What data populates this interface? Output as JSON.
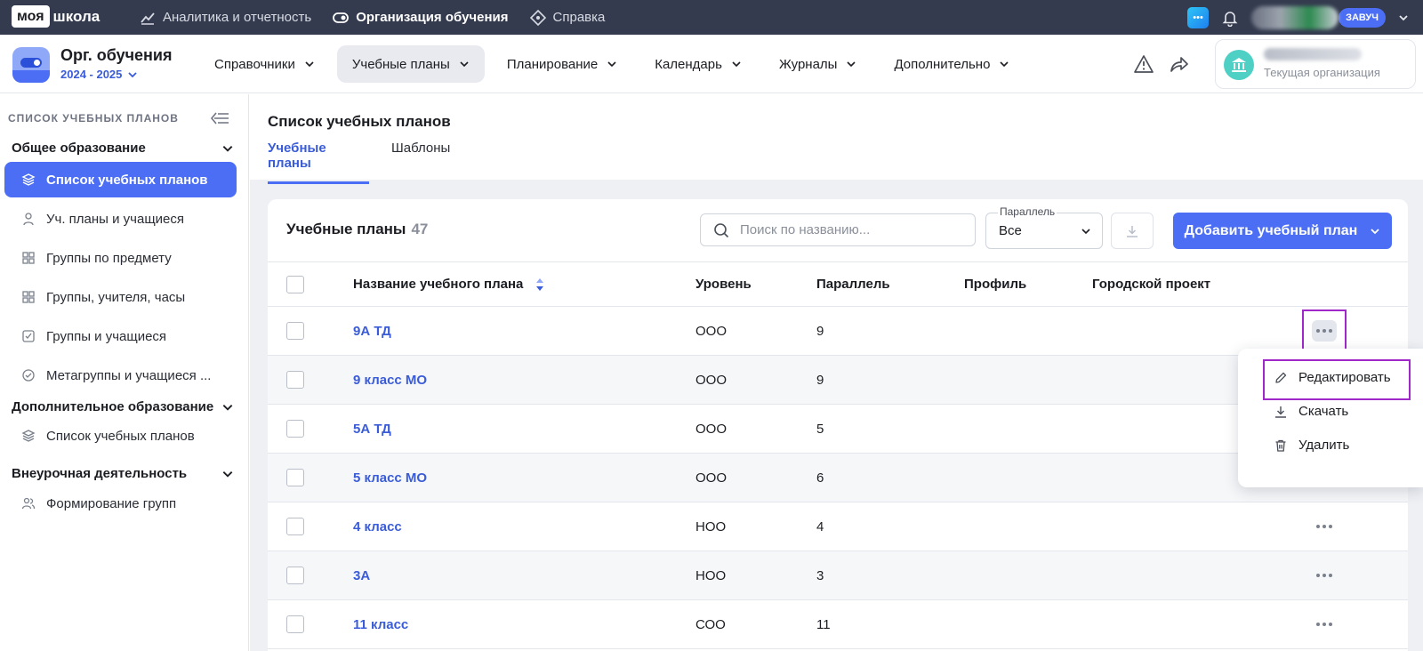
{
  "topbar": {
    "logo_part1": "моя",
    "logo_part2": "школа",
    "nav": [
      {
        "label": "Аналитика и отчетность",
        "icon": "chart-line-icon"
      },
      {
        "label": "Организация обучения",
        "icon": "toggle-icon"
      },
      {
        "label": "Справка",
        "icon": "diamond-icon"
      }
    ],
    "role_badge": "ЗАВУЧ"
  },
  "subbar": {
    "org_title": "Орг. обучения",
    "org_year": "2024 - 2025",
    "nav": [
      "Справочники",
      "Учебные планы",
      "Планирование",
      "Календарь",
      "Журналы",
      "Дополнительно"
    ],
    "org_card_label": "Текущая организация"
  },
  "sidebar": {
    "header": "СПИСОК УЧЕБНЫХ ПЛАНОВ",
    "groups": [
      {
        "title": "Общее образование",
        "items": [
          "Список учебных планов",
          "Уч. планы и учащиеся",
          "Группы по предмету",
          "Группы, учителя, часы",
          "Группы и учащиеся",
          "Метагруппы и учащиеся ..."
        ]
      },
      {
        "title": "Дополнительное образование",
        "items": [
          "Список учебных планов"
        ]
      },
      {
        "title": "Внеурочная деятельность",
        "items": [
          "Формирование групп"
        ]
      }
    ]
  },
  "page": {
    "title": "Список учебных планов",
    "tabs": [
      "Учебные планы",
      "Шаблоны"
    ],
    "card_title": "Учебные планы",
    "count": "47",
    "search_placeholder": "Поиск по названию...",
    "filter_label": "Параллель",
    "filter_value": "Все",
    "add_button": "Добавить учебный план"
  },
  "table": {
    "headers": [
      "Название учебного плана",
      "Уровень",
      "Параллель",
      "Профиль",
      "Городской проект"
    ],
    "rows": [
      {
        "name": "9А ТД",
        "level": "ООО",
        "parallel": "9"
      },
      {
        "name": "9 класс МО",
        "level": "ООО",
        "parallel": "9"
      },
      {
        "name": "5А ТД",
        "level": "ООО",
        "parallel": "5"
      },
      {
        "name": "5 класс МО",
        "level": "ООО",
        "parallel": "6"
      },
      {
        "name": "4 класс",
        "level": "НОО",
        "parallel": "4"
      },
      {
        "name": "3А",
        "level": "НОО",
        "parallel": "3"
      },
      {
        "name": "11 класс",
        "level": "СОО",
        "parallel": "11"
      }
    ]
  },
  "context_menu": {
    "items": [
      {
        "label": "Редактировать",
        "icon": "pencil-icon"
      },
      {
        "label": "Скачать",
        "icon": "download-icon"
      },
      {
        "label": "Удалить",
        "icon": "trash-icon"
      }
    ]
  },
  "colors": {
    "topbar_bg": "#343b4f",
    "accent": "#4b6ef5",
    "link": "#3a5cd9",
    "highlight_frame": "#a028c8"
  }
}
